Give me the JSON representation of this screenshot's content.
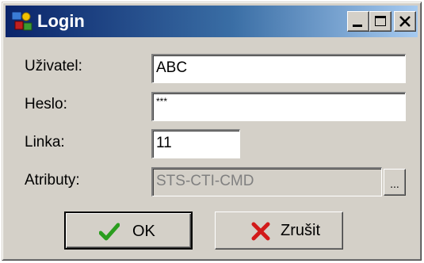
{
  "window": {
    "title": "Login",
    "title_buttons": [
      "minimize",
      "maximize",
      "close"
    ]
  },
  "form": {
    "user_label": "Uživatel:",
    "user_value": "ABC",
    "password_label": "Heslo:",
    "password_value": "***",
    "line_label": "Linka:",
    "line_value": "11",
    "attributes_label": "Atributy:",
    "attributes_value": "STS-CTI-CMD",
    "browse_label": "..."
  },
  "buttons": {
    "ok_label": "OK",
    "cancel_label": "Zrušit"
  },
  "icons": {
    "app": "app-icon",
    "ok": "checkmark-icon",
    "cancel": "x-mark-icon"
  },
  "colors": {
    "title_gradient_start": "#0a246a",
    "title_gradient_end": "#a6caf0",
    "face": "#d4d0c8",
    "ok_check": "#2a9d1e",
    "cancel_x": "#d21a1a"
  }
}
